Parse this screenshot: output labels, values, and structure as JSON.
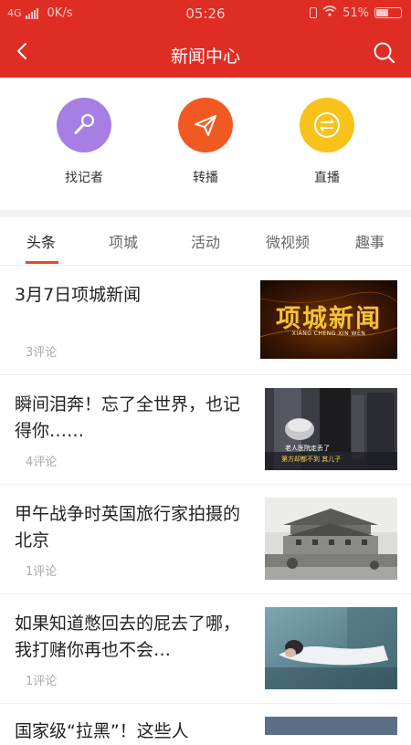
{
  "statusbar": {
    "network": "4G",
    "speed": "0K/s",
    "time": "05:26",
    "battery": "51%"
  },
  "header": {
    "title": "新闻中心"
  },
  "quick_actions": [
    {
      "label": "找记者",
      "icon": "microphone-icon",
      "color": "#a77ee3"
    },
    {
      "label": "转播",
      "icon": "paper-plane-icon",
      "color": "#f05a22"
    },
    {
      "label": "直播",
      "icon": "live-arrows-icon",
      "color": "#f9c21b"
    }
  ],
  "tabs": [
    {
      "label": "头条",
      "active": true
    },
    {
      "label": "项城"
    },
    {
      "label": "活动"
    },
    {
      "label": "微视频"
    },
    {
      "label": "趣事"
    }
  ],
  "news": [
    {
      "title": "3月7日项城新闻",
      "comments": "3评论",
      "thumb_text": "项城新闻",
      "thumb_sub": "XIANG CHENG XIN WEN"
    },
    {
      "title": "瞬间泪奔！忘了全世界，也记得你……",
      "comments": "4评论",
      "thumb_caption1": "老人医院走丢了",
      "thumb_caption2": "第方却都不到 其儿子 "
    },
    {
      "title": "甲午战争时英国旅行家拍摄的北京",
      "comments": "1评论"
    },
    {
      "title": "如果知道憋回去的屁去了哪，我打赌你再也不会…",
      "comments": "1评论"
    },
    {
      "title": "国家级“拉黑”！这些人"
    }
  ],
  "colors": {
    "brand_red": "#e02d23",
    "tab_indicator": "#e24a2c"
  }
}
